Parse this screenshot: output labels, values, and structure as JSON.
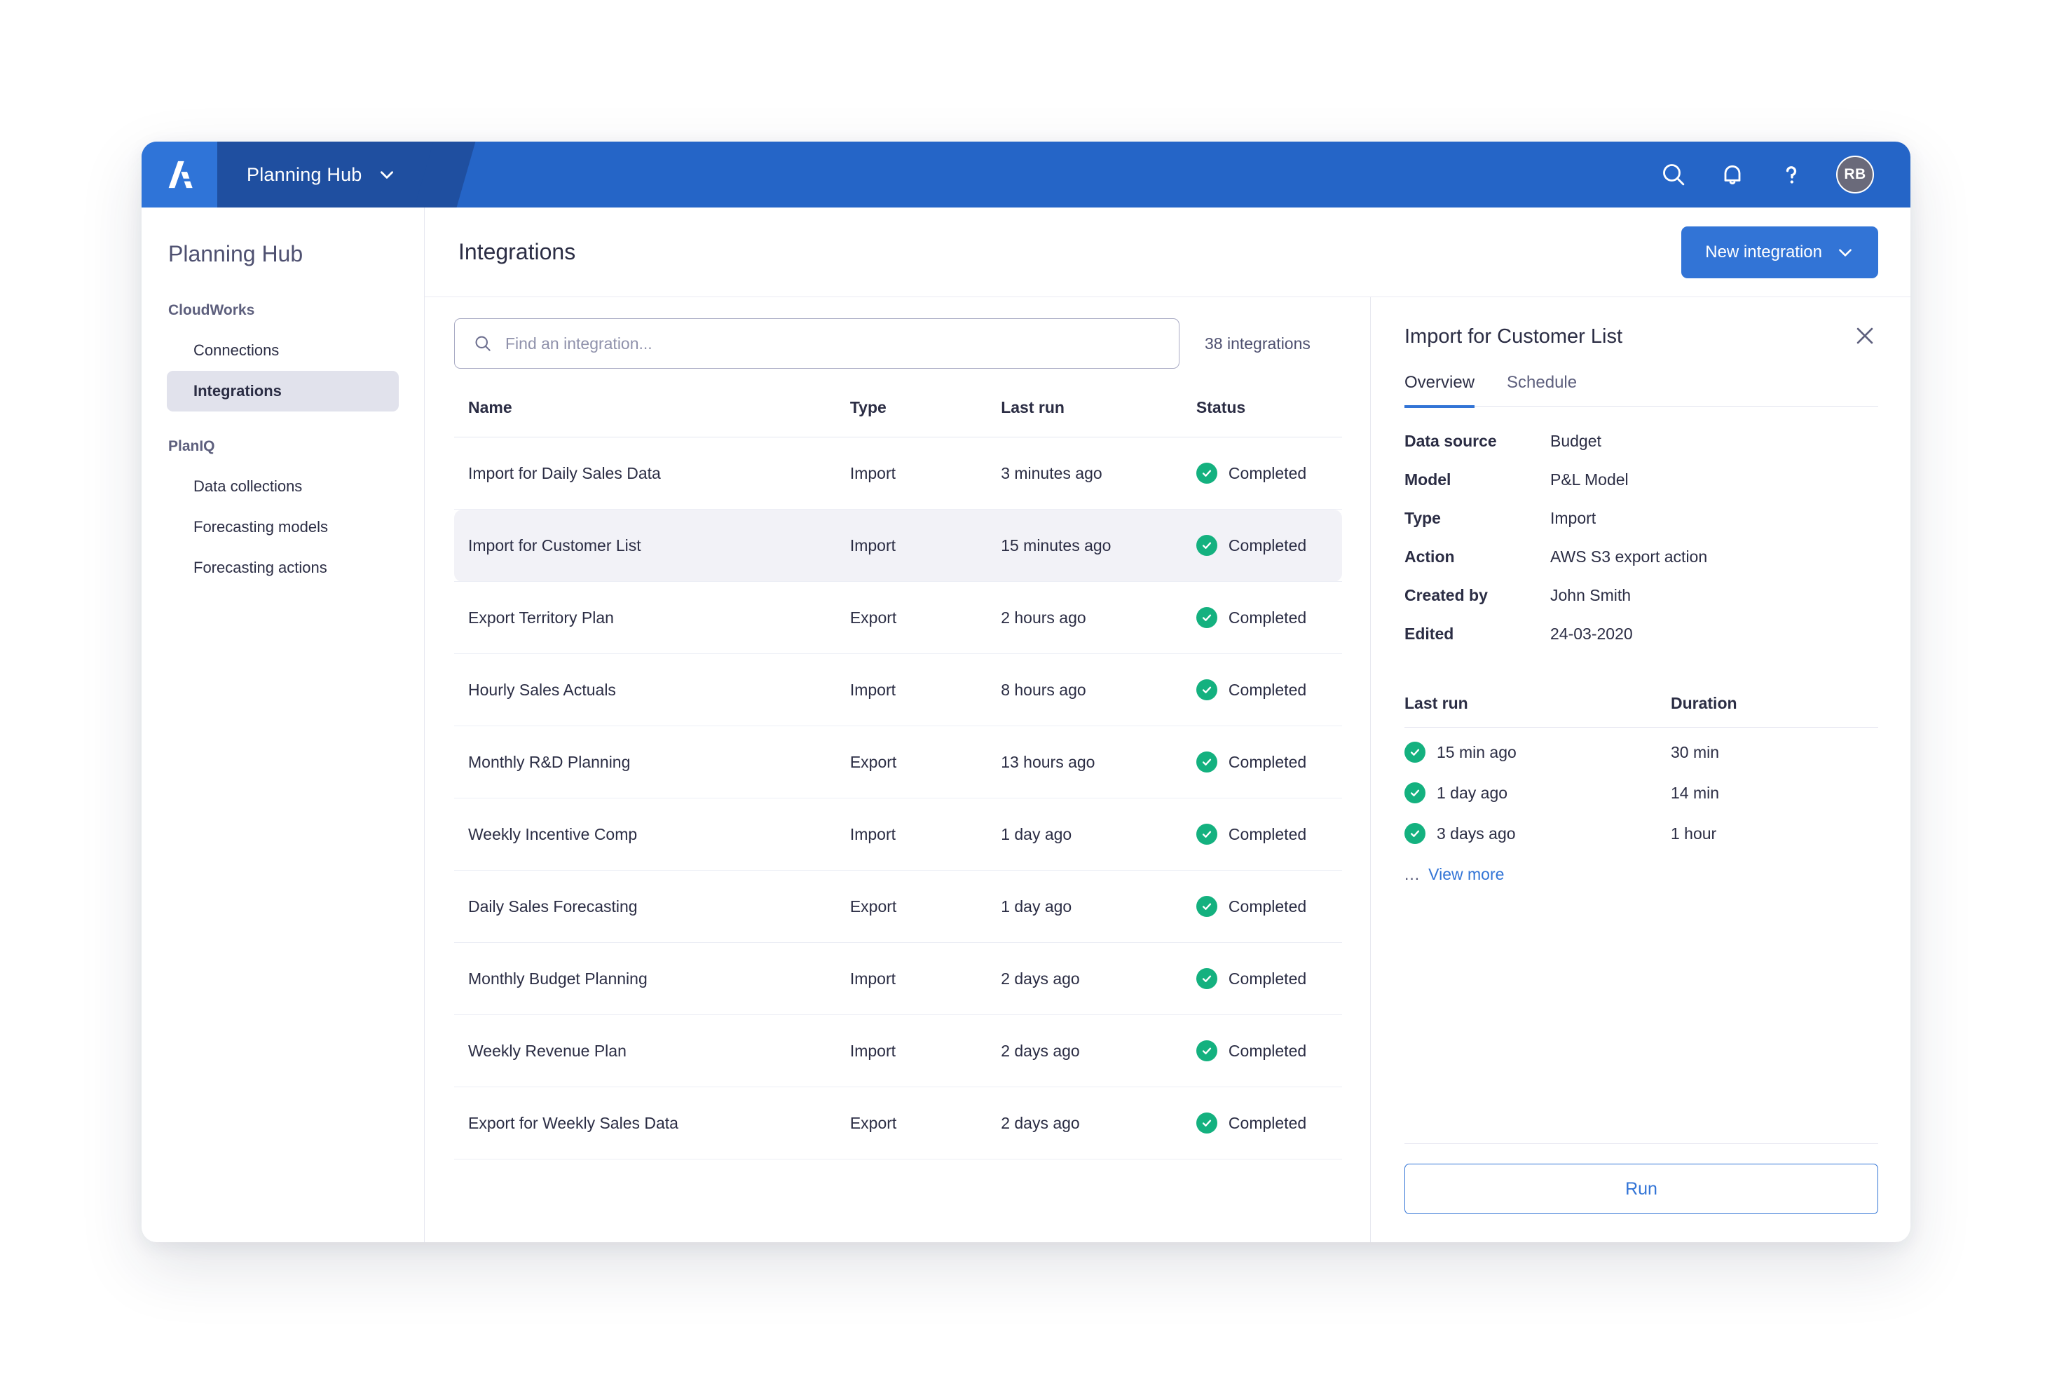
{
  "topbar": {
    "logo_name": "anaplan-logo",
    "workspace": "Planning Hub",
    "avatar_initials": "RB",
    "icons": [
      "search-icon",
      "bell-icon",
      "help-icon"
    ]
  },
  "sidebar": {
    "title": "Planning Hub",
    "groups": [
      {
        "label": "CloudWorks",
        "items": [
          {
            "label": "Connections",
            "active": false
          },
          {
            "label": "Integrations",
            "active": true
          }
        ]
      },
      {
        "label": "PlanIQ",
        "items": [
          {
            "label": "Data collections",
            "active": false
          },
          {
            "label": "Forecasting models",
            "active": false
          },
          {
            "label": "Forecasting actions",
            "active": false
          }
        ]
      }
    ]
  },
  "page": {
    "title": "Integrations",
    "new_button": "New integration"
  },
  "search": {
    "placeholder": "Find an integration...",
    "value": "",
    "count_label": "38 integrations"
  },
  "table": {
    "columns": [
      "Name",
      "Type",
      "Last run",
      "Status"
    ],
    "rows": [
      {
        "name": "Import for Daily Sales Data",
        "type": "Import",
        "last_run": "3 minutes ago",
        "status": "Completed",
        "selected": false
      },
      {
        "name": "Import for Customer List",
        "type": "Import",
        "last_run": "15 minutes ago",
        "status": "Completed",
        "selected": true
      },
      {
        "name": "Export Territory Plan",
        "type": "Export",
        "last_run": "2 hours ago",
        "status": "Completed",
        "selected": false
      },
      {
        "name": "Hourly Sales Actuals",
        "type": "Import",
        "last_run": "8 hours ago",
        "status": "Completed",
        "selected": false
      },
      {
        "name": "Monthly R&D Planning",
        "type": "Export",
        "last_run": "13 hours ago",
        "status": "Completed",
        "selected": false
      },
      {
        "name": "Weekly Incentive Comp",
        "type": "Import",
        "last_run": "1 day ago",
        "status": "Completed",
        "selected": false
      },
      {
        "name": "Daily Sales Forecasting",
        "type": "Export",
        "last_run": "1 day ago",
        "status": "Completed",
        "selected": false
      },
      {
        "name": "Monthly Budget Planning",
        "type": "Import",
        "last_run": "2 days ago",
        "status": "Completed",
        "selected": false
      },
      {
        "name": "Weekly Revenue Plan",
        "type": "Import",
        "last_run": "2 days ago",
        "status": "Completed",
        "selected": false
      },
      {
        "name": "Export for Weekly Sales Data",
        "type": "Export",
        "last_run": "2 days ago",
        "status": "Completed",
        "selected": false
      }
    ]
  },
  "detail": {
    "title": "Import for Customer List",
    "tabs": [
      {
        "label": "Overview",
        "active": true
      },
      {
        "label": "Schedule",
        "active": false
      }
    ],
    "fields": [
      {
        "label": "Data source",
        "value": "Budget"
      },
      {
        "label": "Model",
        "value": "P&L Model"
      },
      {
        "label": "Type",
        "value": "Import"
      },
      {
        "label": "Action",
        "value": "AWS S3 export action"
      },
      {
        "label": "Created by",
        "value": "John Smith"
      },
      {
        "label": "Edited",
        "value": "24-03-2020"
      }
    ],
    "runs_headers": [
      "Last run",
      "Duration"
    ],
    "runs": [
      {
        "when": "15 min ago",
        "duration": "30 min",
        "status": "Completed"
      },
      {
        "when": "1 day ago",
        "duration": "14 min",
        "status": "Completed"
      },
      {
        "when": "3 days ago",
        "duration": "1 hour",
        "status": "Completed"
      }
    ],
    "view_more_dots": "...",
    "view_more": "View more",
    "run_button": "Run"
  },
  "colors": {
    "brand_blue": "#3274d6",
    "header_blue": "#2565c7",
    "header_chip_blue": "#1f4fa0",
    "success_green": "#14b17f",
    "text_dark": "#2b2d44",
    "selected_row": "#f2f2f7"
  }
}
